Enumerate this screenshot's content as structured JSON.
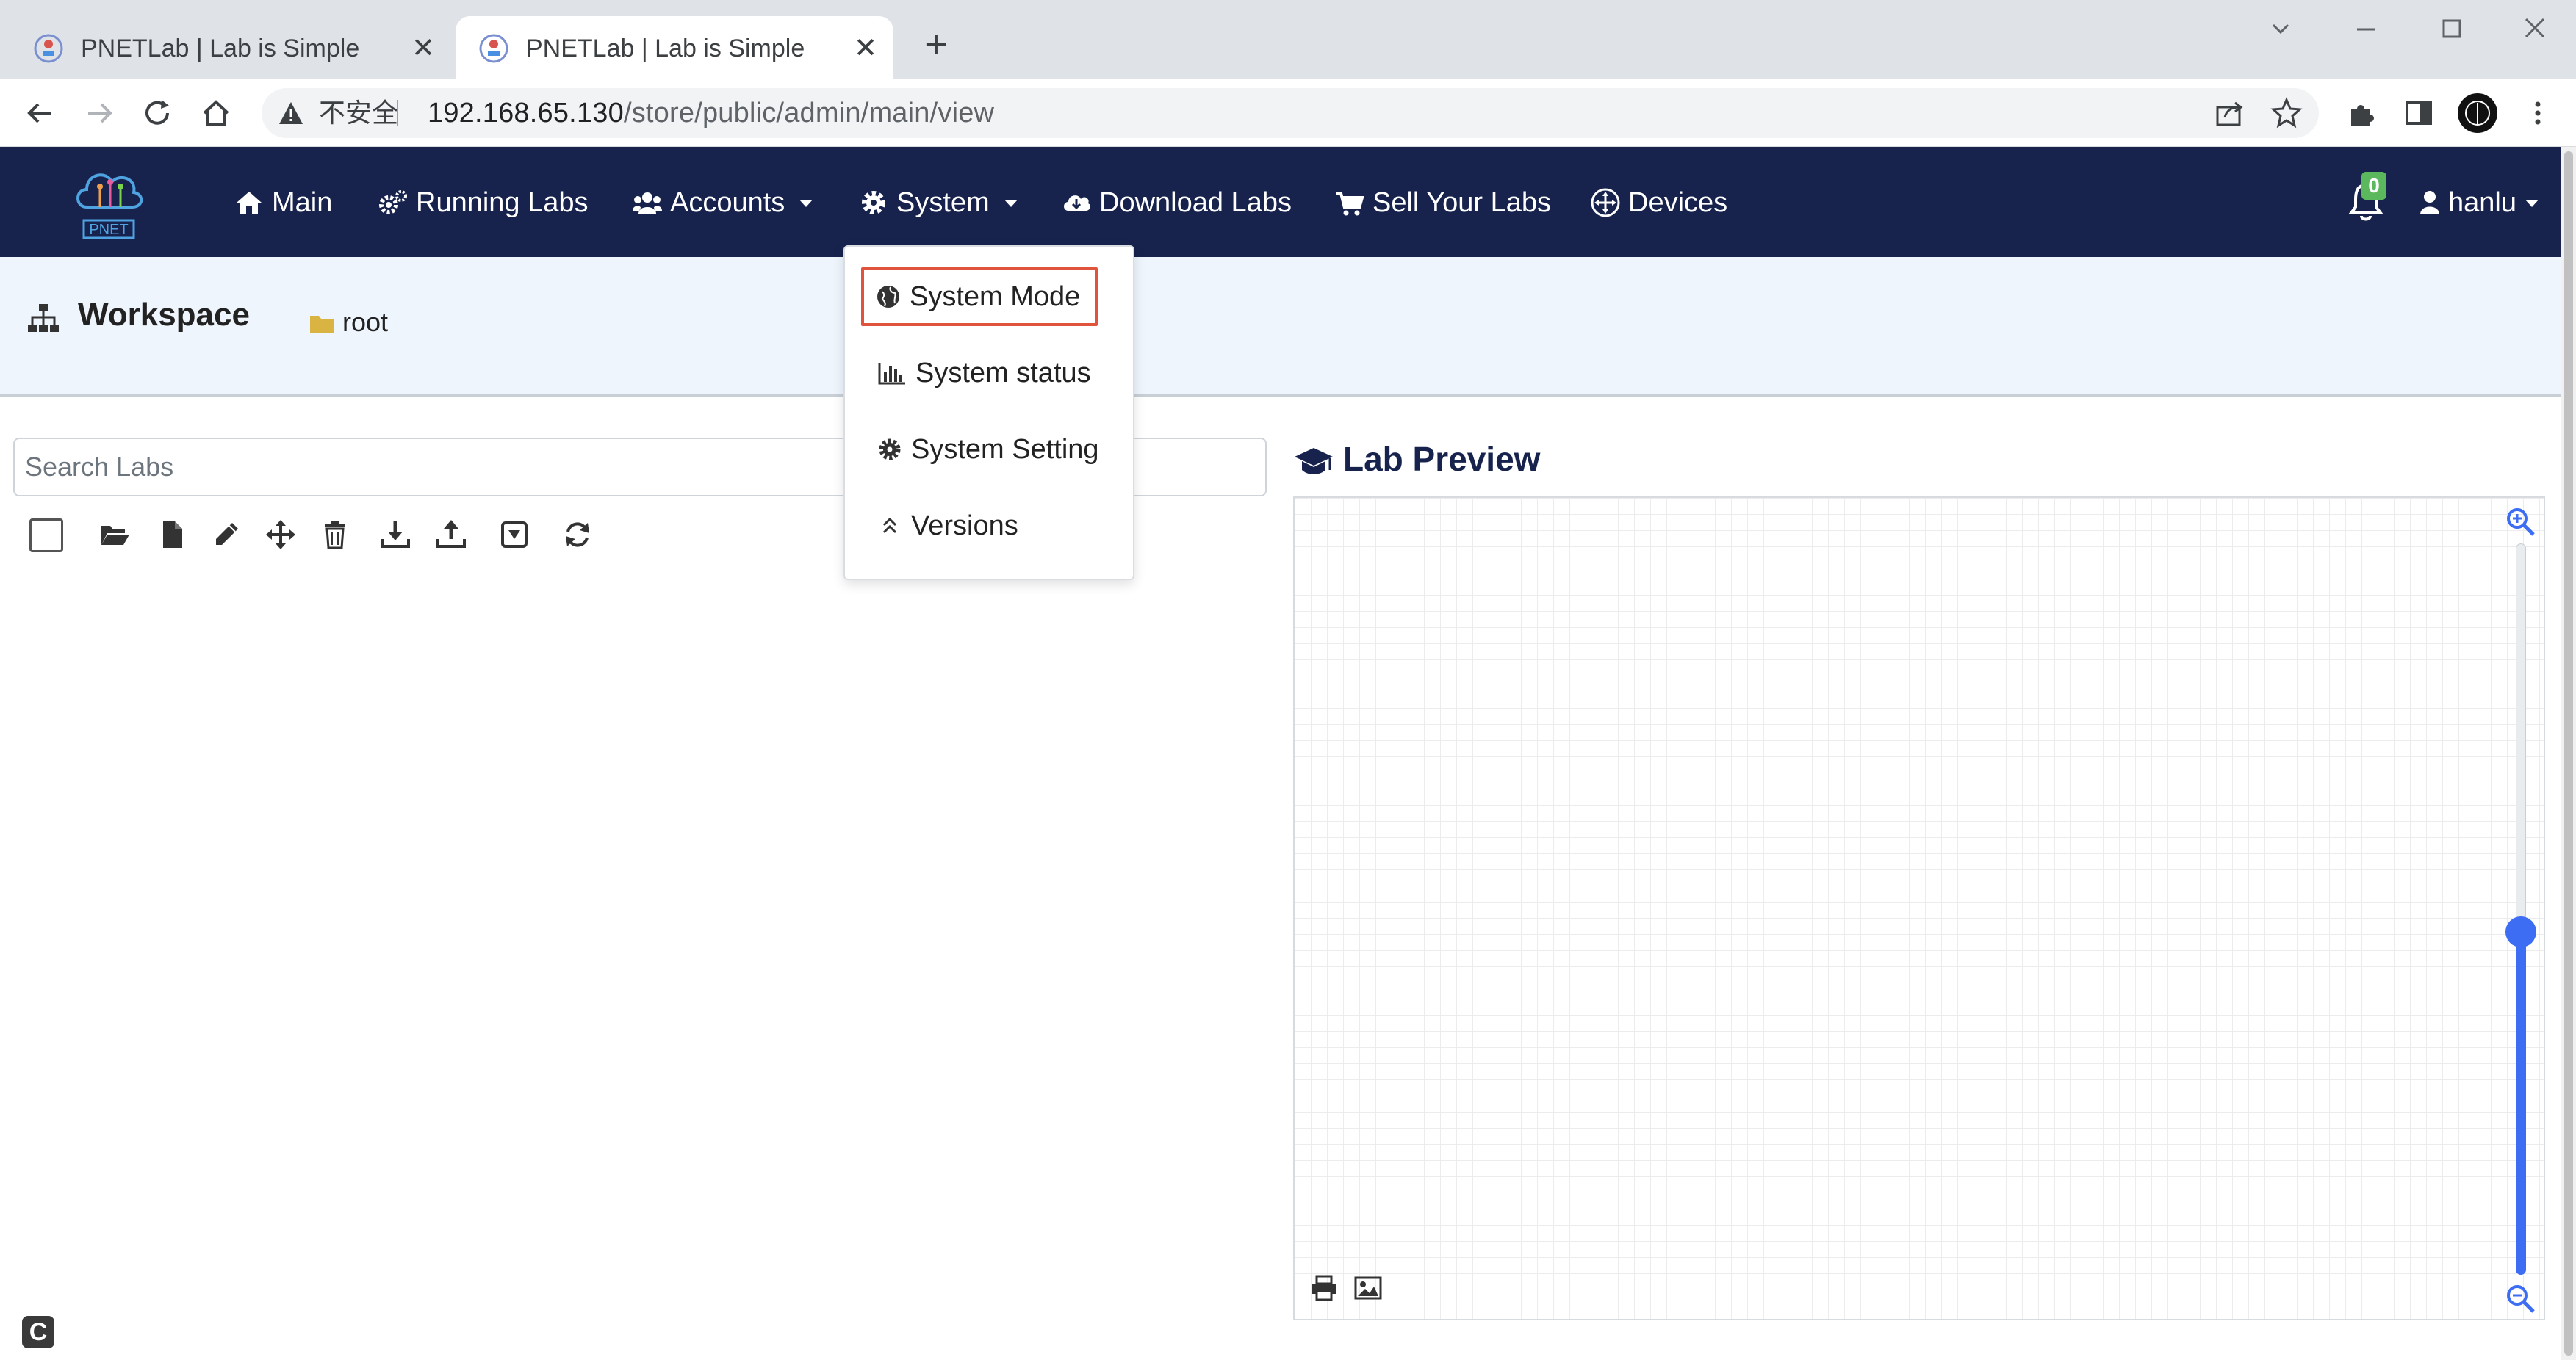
{
  "browser": {
    "tabs": [
      {
        "title": "PNETLab | Lab is Simple",
        "active": false
      },
      {
        "title": "PNETLab | Lab is Simple",
        "active": true
      }
    ],
    "address": {
      "security_label": "不安全",
      "host": "192.168.65.130",
      "path": "/store/public/admin/main/view"
    }
  },
  "navbar": {
    "logo_text": "PNET",
    "items": [
      {
        "label": "Main",
        "icon": "home-icon"
      },
      {
        "label": "Running Labs",
        "icon": "cogs-icon"
      },
      {
        "label": "Accounts",
        "icon": "users-icon",
        "dropdown": true
      },
      {
        "label": "System",
        "icon": "gear-icon",
        "dropdown": true
      },
      {
        "label": "Download Labs",
        "icon": "cloud-download-icon"
      },
      {
        "label": "Sell Your Labs",
        "icon": "cart-icon"
      },
      {
        "label": "Devices",
        "icon": "move-circle-icon"
      }
    ],
    "notifications_count": "0",
    "user": "hanlu"
  },
  "system_menu": {
    "items": [
      {
        "label": "System Mode",
        "icon": "globe-icon",
        "highlighted": true
      },
      {
        "label": "System status",
        "icon": "bar-chart-icon"
      },
      {
        "label": "System Setting",
        "icon": "gear-icon"
      },
      {
        "label": "Versions",
        "icon": "double-chevron-up-icon"
      }
    ]
  },
  "workspace": {
    "title": "Workspace",
    "folder": "root"
  },
  "labs": {
    "search_placeholder": "Search Labs"
  },
  "preview": {
    "title": "Lab Preview",
    "zoom_level_fraction": 0.47
  },
  "colors": {
    "navbar": "#17234d",
    "workspace_bg": "#eef5fd",
    "highlight": "#e0533d",
    "slider": "#3d6df2",
    "badge": "#5cb85c"
  }
}
